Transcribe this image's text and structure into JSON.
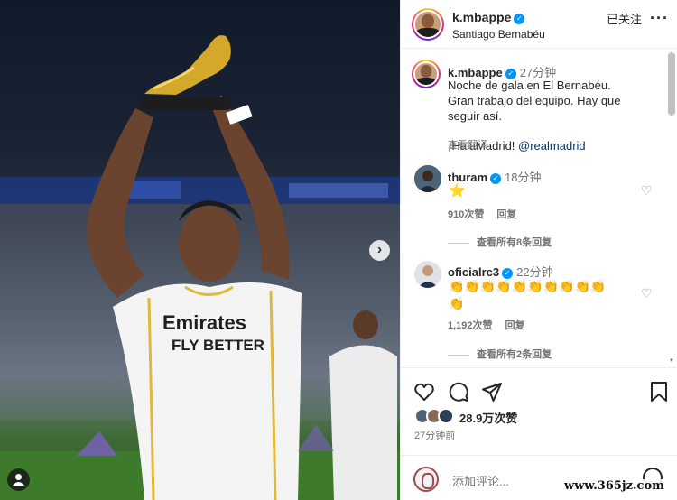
{
  "post": {
    "username": "k.mbappe",
    "location": "Santiago Bernabéu",
    "follow_label": "已关注",
    "more_label": "···"
  },
  "caption": {
    "username": "k.mbappe",
    "time": "27分钟",
    "text": "Noche de gala en El Bernabéu.\nGran trabajo del equipo. Hay que\nseguir así.",
    "text_last": "¡HalaMadrid! ",
    "mention": "@realmadrid",
    "translate": "查看翻译"
  },
  "comments": [
    {
      "username": "thuram",
      "time": "18分钟",
      "text": "⭐",
      "likes": "910次赞",
      "reply": "回复",
      "view_replies": "查看所有8条回复"
    },
    {
      "username": "oficialrc3",
      "time": "22分钟",
      "text": "👏👏👏👏👏👏👏👏👏👏\n👏",
      "likes": "1,192次赞",
      "reply": "回复",
      "view_replies": "查看所有2条回复"
    }
  ],
  "actions": {
    "likes": "28.9万次赞",
    "posted": "27分钟前"
  },
  "add_comment": {
    "placeholder": "添加评论..."
  },
  "watermark": "www.365jz.com",
  "icons": {
    "like": "heart-icon",
    "comment": "comment-icon",
    "share": "share-icon",
    "save": "bookmark-icon",
    "next": "chevron-right-icon",
    "tag": "user-tag-icon",
    "emoji": "emoji-icon"
  },
  "colors": {
    "verified": "#0095f6",
    "link": "#00376b",
    "muted": "#737373"
  }
}
